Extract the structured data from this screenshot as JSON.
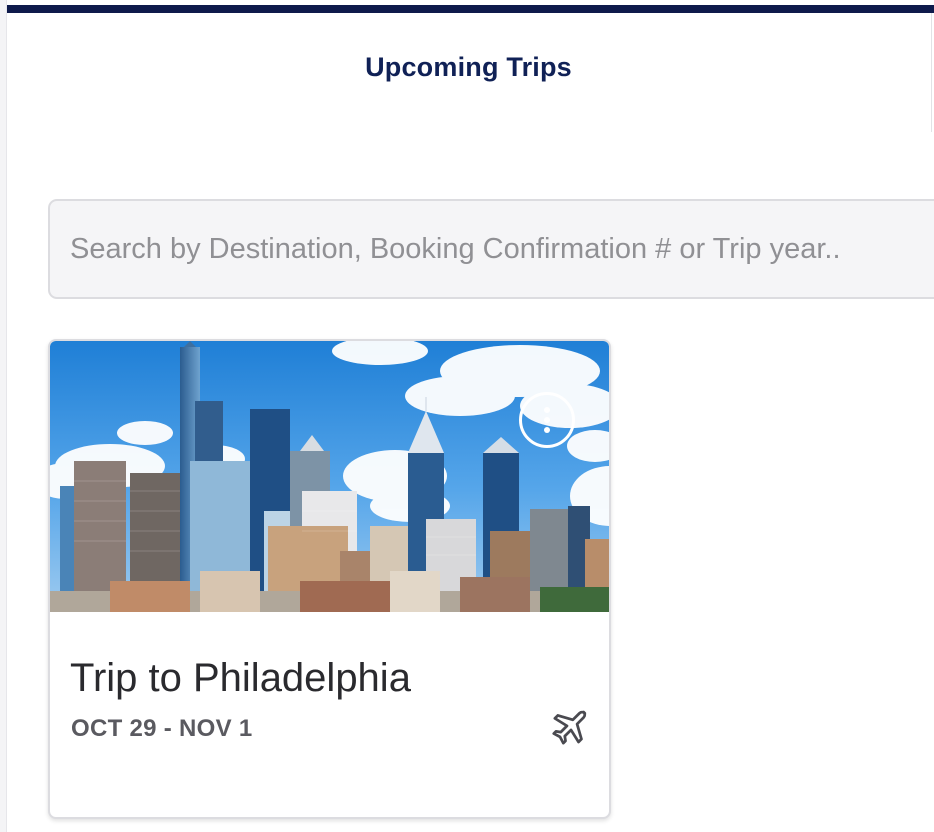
{
  "header": {
    "title": "Upcoming Trips"
  },
  "search": {
    "placeholder": "Search by Destination, Booking Confirmation # or Trip year.."
  },
  "trips": [
    {
      "title": "Trip to Philadelphia",
      "dates": "OCT 29 - NOV 1",
      "image": "philadelphia-skyline",
      "type_icon": "airplane-icon",
      "menu_icon": "more-vertical-icon"
    }
  ],
  "colors": {
    "brand_navy": "#0e1a4b",
    "title_text": "#102156",
    "card_title": "#2a2a2e",
    "card_dates": "#5a5a60",
    "search_bg": "#f5f5f7"
  }
}
